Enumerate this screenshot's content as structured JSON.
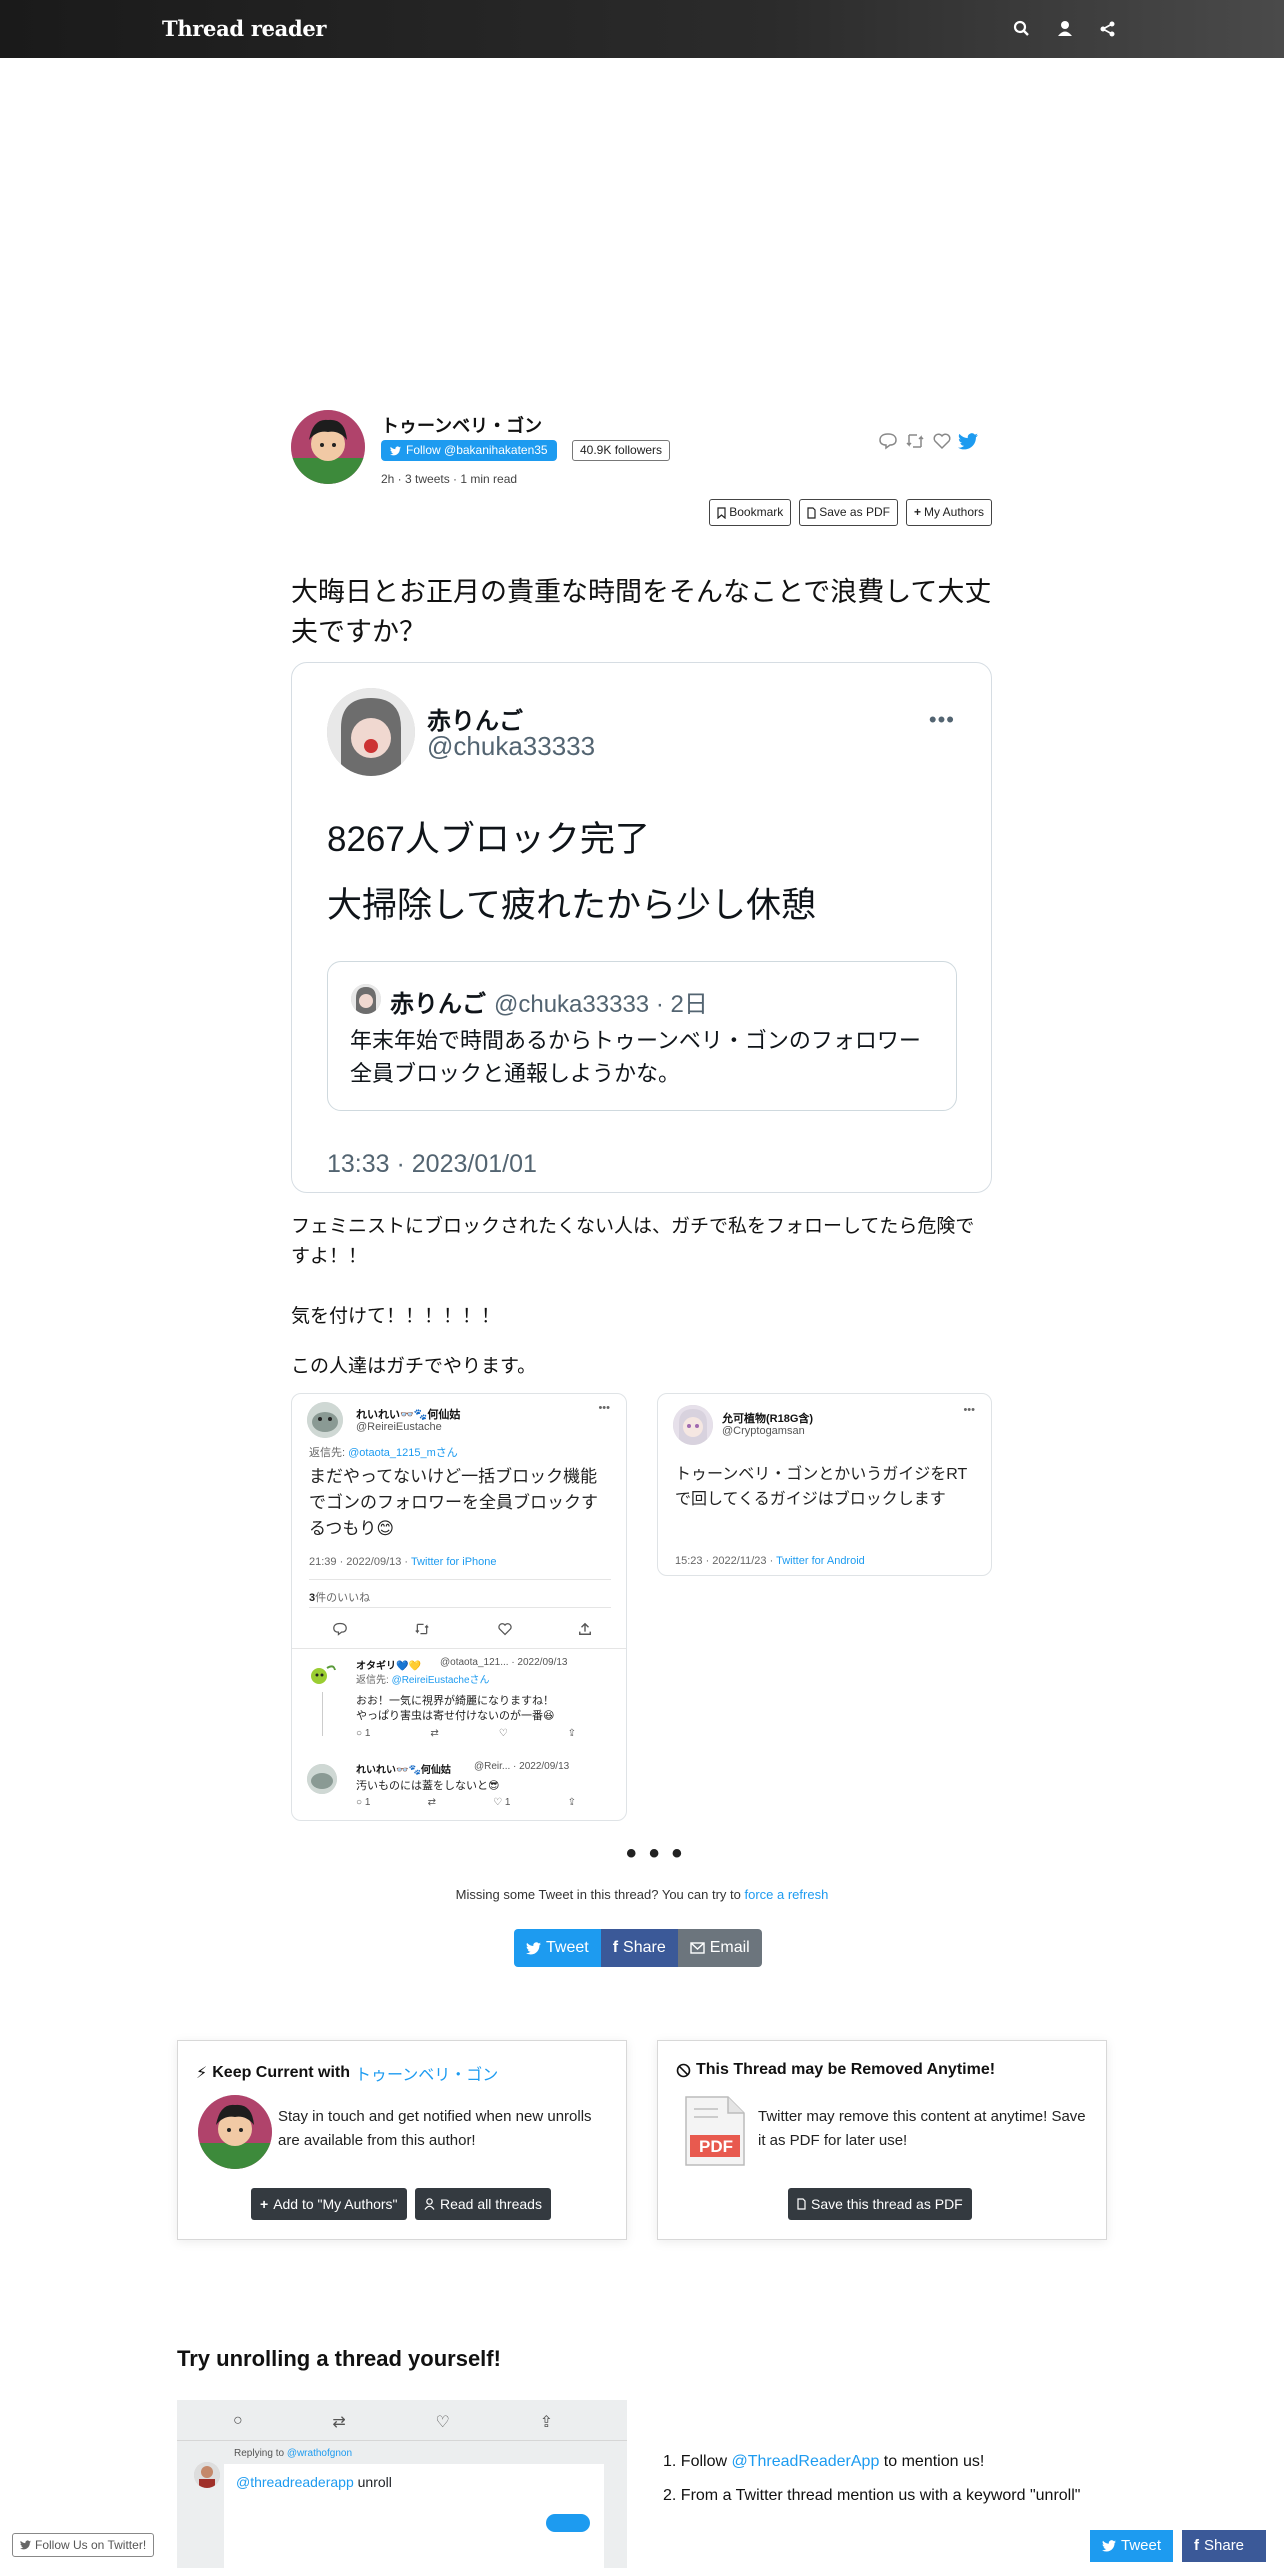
{
  "app": {
    "brand": "Thread reader",
    "nav_icons": [
      "search-icon",
      "user-icon",
      "share-icon"
    ]
  },
  "author": {
    "name": "トゥーンベリ・ゴン",
    "follow_label": "Follow @bakanihakaten35",
    "followers": "40.9K followers",
    "meta": "2h · 3 tweets · 1 min read",
    "actions": {
      "bookmark": "Bookmark",
      "save_pdf": "Save as PDF",
      "my_authors": "My Authors"
    }
  },
  "thread": {
    "lead": "大晦日とお正月の貴重な時間をそんなことで浪費して大丈夫ですか？",
    "embedded_tweet": {
      "name": "赤りんご",
      "handle": "@chuka33333",
      "body_line1": "8267人ブロック完了",
      "body_line2": "大掃除して疲れたから少し休憩",
      "quote": {
        "name": "赤りんご",
        "handle": "@chuka33333 · 2日",
        "body": "年末年始で時間あるからトゥーンベリ・ゴンのフォロワー全員ブロックと通報しようかな。"
      },
      "timestamp": "13:33 · 2023/01/01"
    },
    "para1": "フェミニストにブロックされたくない人は、ガチで私をフォローしてたら危険ですよ！！",
    "para2": "気を付けて！！！！！！",
    "para3": "この人達はガチでやります。",
    "card_left": {
      "name": "れいれい👓🐾何仙姑",
      "handle": "@ReireiEustache",
      "reply_to_prefix": "返信先: ",
      "reply_to": "@otaota_1215_mさん",
      "body": "まだやってないけど一括ブロック機能でゴンのフォロワーを全員ブロックするつもり😊",
      "time": "21:39 · 2022/09/13 · ",
      "client": "Twitter for iPhone",
      "likes_num": "3",
      "likes_label": "件のいいね",
      "reply1": {
        "name": "オタギリ💙💛",
        "handle": "@otaota_121... · 2022/09/13",
        "reply_to_prefix": "返信先: ",
        "reply_to": "@ReireiEustacheさん",
        "line1": "おお！一気に視界が綺麗になりますね！",
        "line2": "やっぱり害虫は寄せ付けないのが一番😆",
        "reply_count": "1",
        "like_count": ""
      },
      "reply2": {
        "name": "れいれい👓🐾何仙姑",
        "handle": "@Reir... · 2022/09/13",
        "line1": "汚いものには蓋をしないと😎",
        "reply_count": "1",
        "like_count": "1"
      }
    },
    "card_right": {
      "name": "允可植物(R18G含)",
      "handle": "@Cryptogamsan",
      "body": "トゥーンベリ・ゴンとかいうガイジをRTで回してくるガイジはブロックします",
      "time": "15:23 · 2022/11/23 · ",
      "client": "Twitter for Android"
    },
    "ellipsis": "• • •",
    "missing_text": "Missing some Tweet in this thread? You can try to ",
    "missing_link": "force a refresh"
  },
  "share": {
    "tweet": "Tweet",
    "share": "Share",
    "email": "Email"
  },
  "keep_current": {
    "title_prefix": "Keep Current with ",
    "title_author": "トゥーンベリ・ゴン",
    "text": "Stay in touch and get notified when new unrolls are available from this author!",
    "add_btn": "Add to \"My Authors\"",
    "read_btn": "Read all threads"
  },
  "removed": {
    "title": "This Thread may be Removed Anytime!",
    "text": "Twitter may remove this content at anytime! Save it as PDF for later use!",
    "pdf_label": "PDF",
    "save_btn": "Save this thread as PDF"
  },
  "try": {
    "title": "Try unrolling a thread yourself!",
    "demo_reply_prefix": "Replying to ",
    "demo_reply_to": "@wrathofgnon",
    "demo_mention": "@threadreaderapp",
    "demo_word": " unroll",
    "step1_prefix": "1. Follow ",
    "step1_link": "@ThreadReaderApp",
    "step1_suffix": " to mention us!",
    "step2": "2. From a Twitter thread mention us with a keyword \"unroll\""
  },
  "footer": {
    "follow_us": "Follow Us on Twitter!",
    "tweet": "Tweet",
    "share": "Share"
  },
  "colors": {
    "twitter_blue": "#1d9bf0",
    "facebook_blue": "#3b5998",
    "email_grey": "#6c757d",
    "dark_button": "#343a40"
  }
}
